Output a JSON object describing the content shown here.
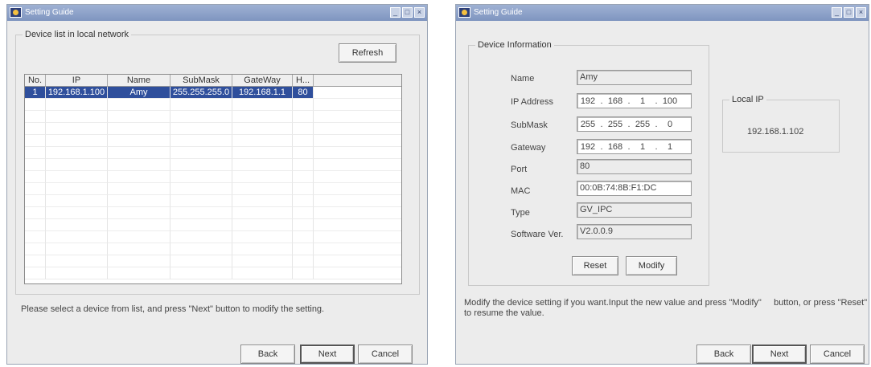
{
  "left": {
    "title": "Setting Guide",
    "group_label": "Device list in local network",
    "refresh_label": "Refresh",
    "columns": [
      "No.",
      "IP",
      "Name",
      "SubMask",
      "GateWay",
      "H..."
    ],
    "rows": [
      [
        "1",
        "192.168.1.100",
        "Amy",
        "255.255.255.0",
        "192.168.1.1",
        "80"
      ]
    ],
    "instruction": "Please select a device from list, and press \"Next\" button to modify the setting.",
    "back_label": "Back",
    "next_label": "Next",
    "cancel_label": "Cancel"
  },
  "right": {
    "title": "Setting Guide",
    "group_label": "Device Information",
    "name_label": "Name",
    "name_value": "Amy",
    "ip_label": "IP Address",
    "ip_octets": [
      "192",
      "168",
      "1",
      "100"
    ],
    "mask_label": "SubMask",
    "mask_octets": [
      "255",
      "255",
      "255",
      "0"
    ],
    "gateway_label": "Gateway",
    "gateway_octets": [
      "192",
      "168",
      "1",
      "1"
    ],
    "port_label": "Port",
    "port_value": "80",
    "mac_label": "MAC",
    "mac_value": "00:0B:74:8B:F1:DC",
    "type_label": "Type",
    "type_value": "GV_IPC",
    "software_label": "Software Ver.",
    "software_value": "V2.0.0.9",
    "reset_label": "Reset",
    "modify_label": "Modify",
    "local_ip_label": "Local IP",
    "local_ip_value": "192.168.1.102",
    "instruction_line1": "Modify the device setting if you want.Input the new value and press \"Modify\"     button, or press \"Reset\"",
    "instruction_line2": "to resume the value.",
    "back_label": "Back",
    "next_label": "Next",
    "cancel_label": "Cancel"
  },
  "icons": {
    "app_icon": "app-logo-icon",
    "minimize": "minimize-icon",
    "maximize": "maximize-icon",
    "close": "close-icon"
  }
}
